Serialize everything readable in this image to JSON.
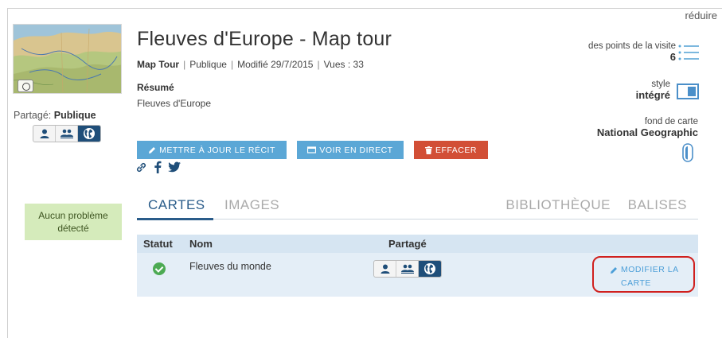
{
  "header": {
    "collapse_label": "réduire"
  },
  "story": {
    "title": "Fleuves d'Europe - Map tour",
    "type": "Map Tour",
    "visibility": "Publique",
    "modified": "Modifié 29/7/2015",
    "views": "Vues : 33",
    "summary_heading": "Résumé",
    "summary_text": "Fleuves d'Europe"
  },
  "sidebar": {
    "shared_prefix": "Partagé:",
    "shared_value": "Publique",
    "status_text": "Aucun problème détecté"
  },
  "actions": {
    "update_label": "METTRE À JOUR LE RÉCIT",
    "live_label": "VOIR EN DIRECT",
    "delete_label": "EFFACER"
  },
  "properties": {
    "points_label": "des points de la visite",
    "points_value": "6",
    "style_label": "style",
    "style_value": "intégré",
    "basemap_label": "fond de carte",
    "basemap_value": "National Geographic"
  },
  "tabs": [
    "CARTES",
    "IMAGES",
    "BIBLIOTHÈQUE",
    "BALISES"
  ],
  "table": {
    "headers": {
      "status": "Statut",
      "name": "Nom",
      "sharing": "Partagé"
    },
    "rows": [
      {
        "name": "Fleuves du monde",
        "edit_label": "MODIFIER LA CARTE"
      }
    ]
  },
  "colors": {
    "accent": "#5ba7d6",
    "danger": "#d24f36",
    "tab_active": "#2a5c8a",
    "status_ok": "#d5ebbb",
    "highlight": "#d0201e"
  },
  "icons": [
    "camera-icon",
    "user-icon",
    "group-icon",
    "globe-icon",
    "pencil-icon",
    "monitor-icon",
    "trash-icon",
    "link-icon",
    "facebook-icon",
    "twitter-icon",
    "list-icon",
    "layout-icon",
    "map-pin-icon",
    "check-icon"
  ]
}
